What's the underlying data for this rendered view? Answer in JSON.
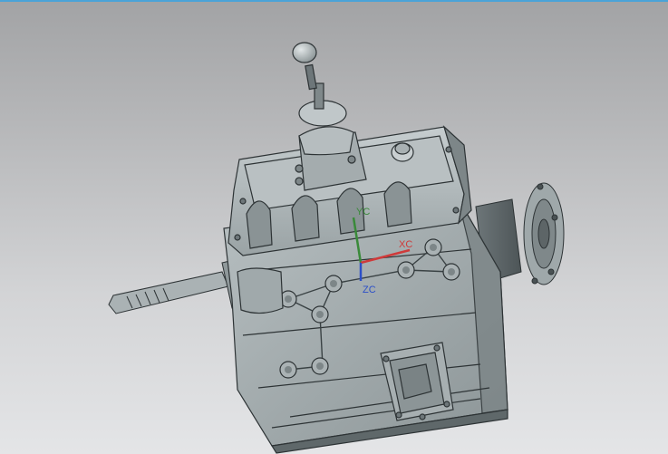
{
  "viewport": {
    "top_border_color": "#4aa3d8",
    "background_colors": [
      "#a2a3a5",
      "#e4e5e7"
    ]
  },
  "model": {
    "name_icon": "gearbox-3d-model",
    "body_color": "#9ea7a9",
    "edge_color": "#2d3335"
  },
  "triad": {
    "y_label": "YC",
    "x_label": "XC",
    "z_label": "ZC",
    "y_color": "#3a8a3a",
    "x_color": "#cf3a3a",
    "z_color": "#2c4fc8"
  }
}
